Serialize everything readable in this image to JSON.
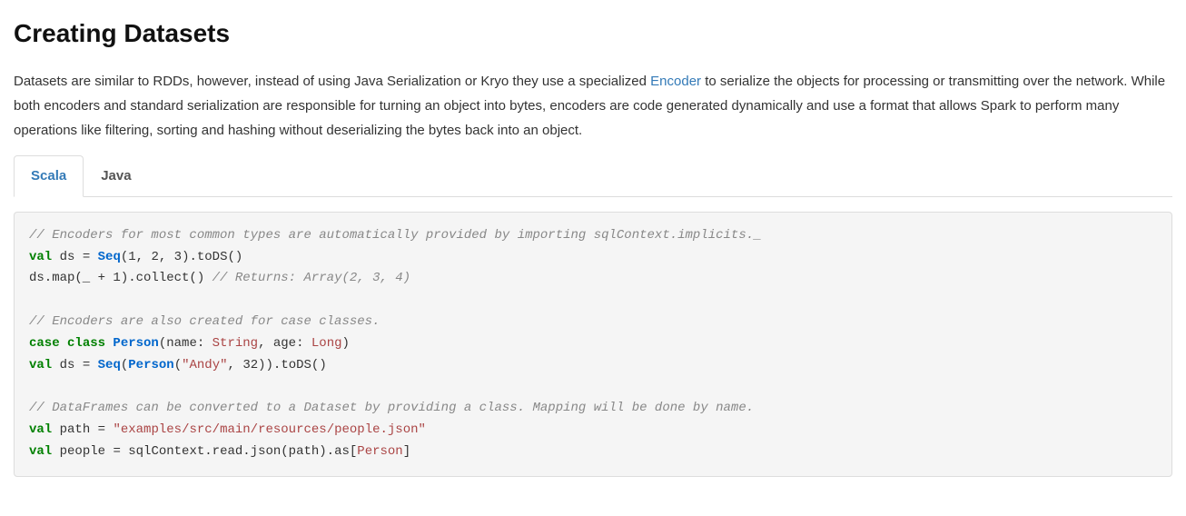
{
  "heading": "Creating Datasets",
  "intro": {
    "part1": "Datasets are similar to RDDs, however, instead of using Java Serialization or Kryo they use a specialized ",
    "link_text": "Encoder",
    "part2": " to serialize the objects for processing or transmitting over the network. While both encoders and standard serialization are responsible for turning an object into bytes, encoders are code generated dynamically and use a format that allows Spark to perform many operations like filtering, sorting and hashing without deserializing the bytes back into an object."
  },
  "tabs": [
    {
      "label": "Scala",
      "active": true
    },
    {
      "label": "Java",
      "active": false
    }
  ],
  "code": {
    "c1": "// Encoders for most common types are automatically provided by importing sqlContext.implicits._",
    "l1_val": "val",
    "l1_ds": " ds ",
    "l1_eq": "= ",
    "l1_seq": "Seq",
    "l1_args": "(1, 2, 3).toDS()",
    "l2_a": "ds.map(_ + 1).collect() ",
    "l2_c": "// Returns: Array(2, 3, 4)",
    "c2": "// Encoders are also created for case classes.",
    "l3_case": "case",
    "l3_class": " class ",
    "l3_person": "Person",
    "l3_open": "(name: ",
    "l3_string": "String",
    "l3_comma": ", age: ",
    "l3_long": "Long",
    "l3_close": ")",
    "l4_val": "val",
    "l4_ds": " ds ",
    "l4_eq": "= ",
    "l4_seq": "Seq",
    "l4_open": "(",
    "l4_person": "Person",
    "l4_args": "(",
    "l4_andy": "\"Andy\"",
    "l4_rest": ", 32)).toDS()",
    "c3": "// DataFrames can be converted to a Dataset by providing a class. Mapping will be done by name.",
    "l5_val": "val",
    "l5_path": " path ",
    "l5_eq": "= ",
    "l5_str": "\"examples/src/main/resources/people.json\"",
    "l6_val": "val",
    "l6_people": " people ",
    "l6_eq": "= ",
    "l6_call": "sqlContext.read.json(path).as[",
    "l6_person": "Person",
    "l6_close": "]"
  }
}
